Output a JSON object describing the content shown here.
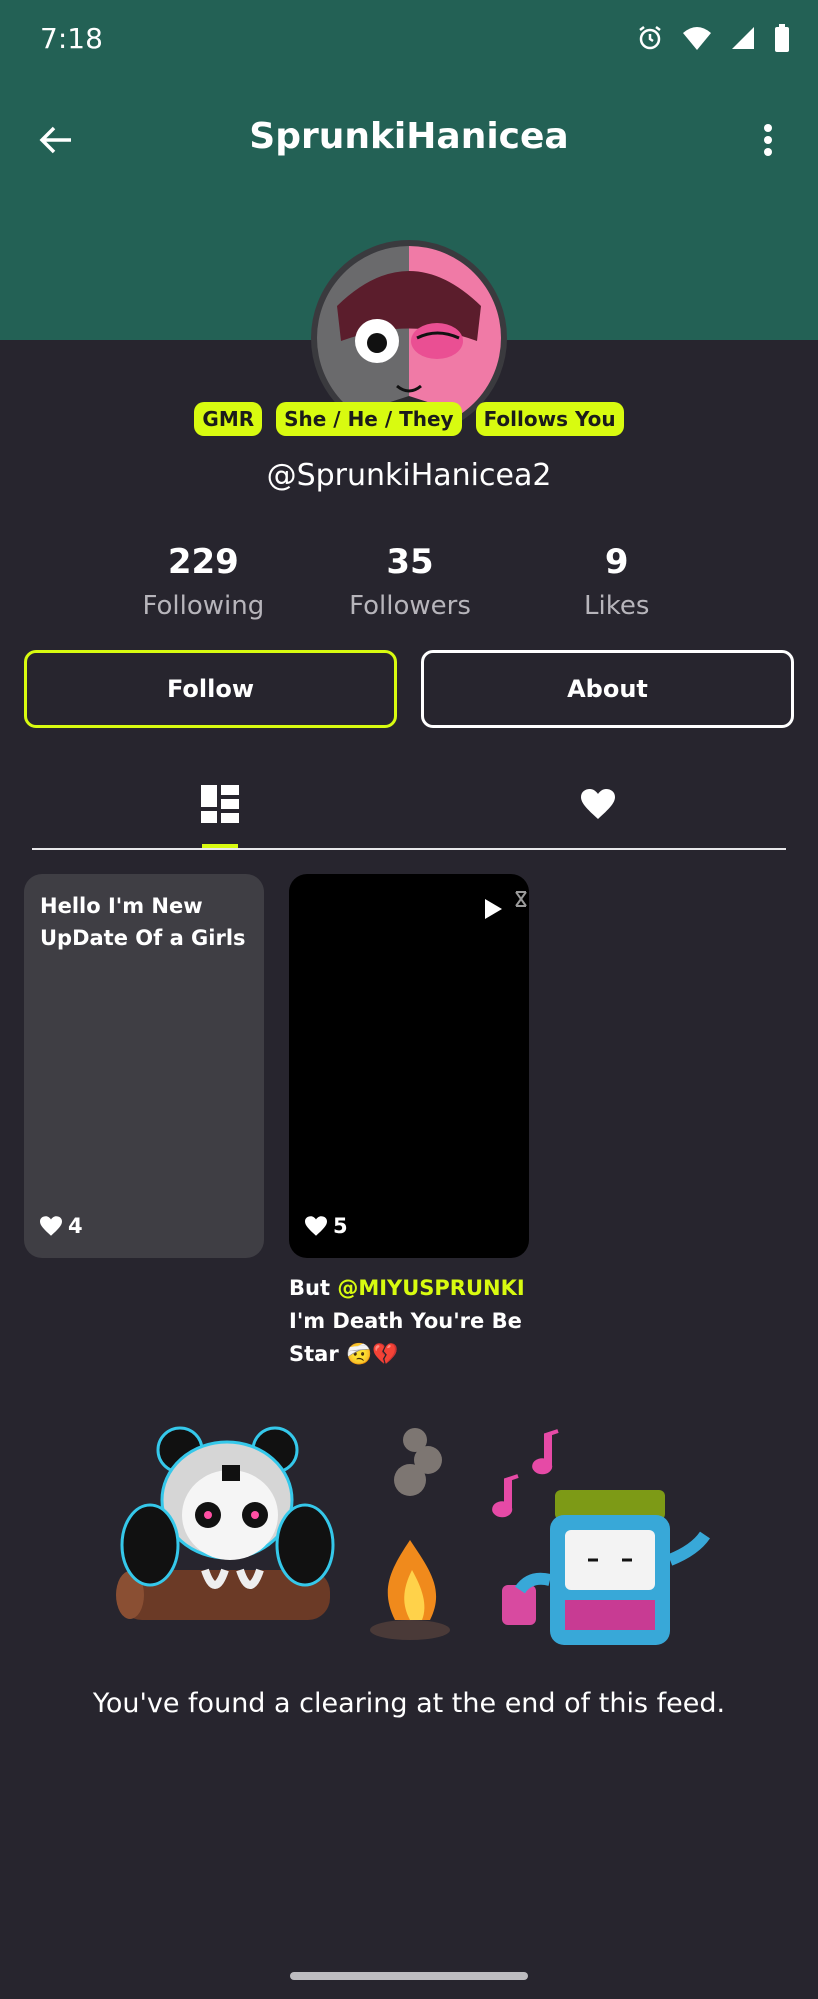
{
  "status_bar": {
    "time": "7:18"
  },
  "header": {
    "title": "SprunkiHanicea"
  },
  "profile": {
    "badges": [
      "GMR",
      "She / He / They",
      "Follows You"
    ],
    "handle": "@SprunkiHanicea2",
    "stats": [
      {
        "value": "229",
        "label": "Following"
      },
      {
        "value": "35",
        "label": "Followers"
      },
      {
        "value": "9",
        "label": "Likes"
      }
    ]
  },
  "actions": {
    "follow": "Follow",
    "about": "About"
  },
  "posts": [
    {
      "text": "Hello I'm New UpDate Of a Girls",
      "likes": "4"
    },
    {
      "likes": "5",
      "caption_prefix": "But ",
      "caption_mention": "@MIYUSPRUNKI",
      "caption_rest": "I'm Death You're Be Star 🤕💔"
    }
  ],
  "feed_end": "You've found a clearing at the end of this feed.",
  "colors": {
    "accent": "#d8fb10",
    "header": "#236155",
    "background": "#27252e"
  }
}
